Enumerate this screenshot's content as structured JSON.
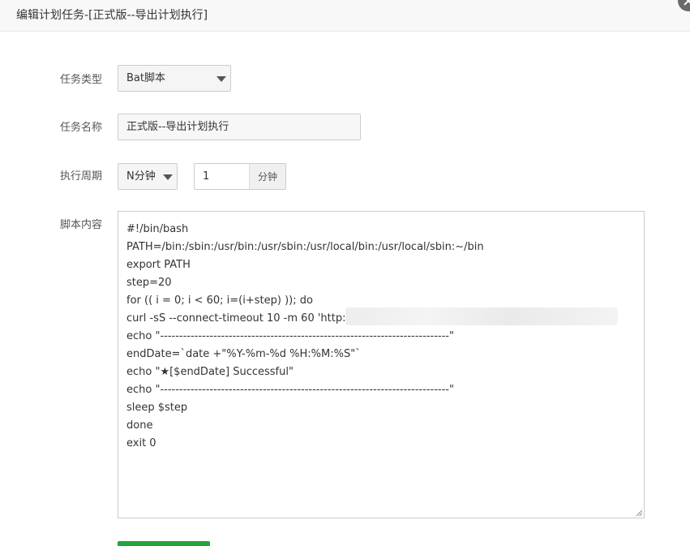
{
  "dialog": {
    "title": "编辑计划任务-[正式版--导出计划执行]"
  },
  "form": {
    "task_type": {
      "label": "任务类型",
      "value": "Bat脚本"
    },
    "task_name": {
      "label": "任务名称",
      "value": "正式版--导出计划执行"
    },
    "period": {
      "label": "执行周期",
      "unit_select": "N分钟",
      "value": "1",
      "unit_addon": "分钟"
    },
    "script": {
      "label": "脚本内容",
      "lines": [
        "#!/bin/bash",
        "PATH=/bin:/sbin:/usr/bin:/usr/sbin:/usr/local/bin:/usr/local/sbin:~/bin",
        "export PATH",
        "step=20",
        "for (( i = 0; i < 60; i=(i+step) )); do",
        "curl -sS --connect-timeout 10 -m 60 'http://",
        "echo \"----------------------------------------------------------------------------\"",
        "endDate=`date +\"%Y-%m-%d %H:%M:%S\"`",
        "echo \"★[$endDate] Successful\"",
        "echo \"----------------------------------------------------------------------------\"",
        "sleep $step",
        "done",
        "exit 0"
      ]
    }
  },
  "colors": {
    "primary_button": "#20a53a",
    "title_bar_bg": "#f8f8f8"
  }
}
